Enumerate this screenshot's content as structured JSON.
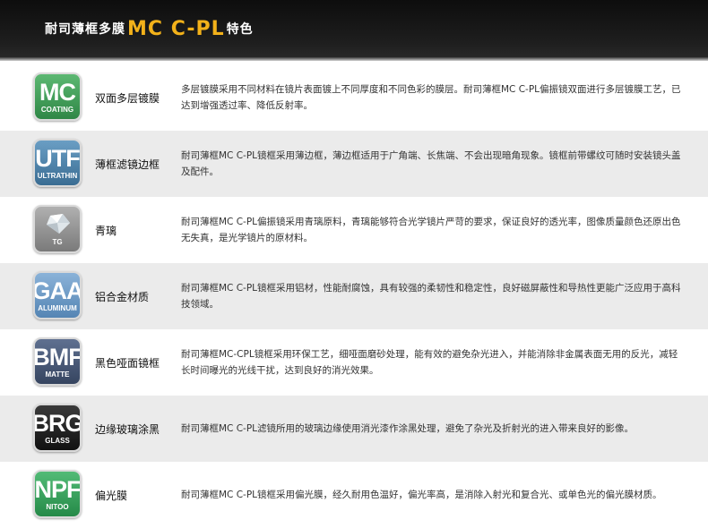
{
  "header": {
    "title_prefix": "耐司薄框多膜",
    "title_highlight": "MC C-PL",
    "title_suffix": "特色"
  },
  "colors": {
    "highlight": "#f2b11a",
    "mc": "#3e9a56",
    "utf": "#4a7fa6",
    "tg": "#8c8c8c",
    "gaa": "#6b98c6",
    "bmf": "#4a5a78",
    "brg": "#222222",
    "npf": "#35a05c"
  },
  "features": [
    {
      "icon": "mc-coating-icon",
      "abbr": "MC",
      "sub": "COATING",
      "name": "双面多层镀膜",
      "desc": "多层镀膜采用不同材料在镜片表面镀上不同厚度和不同色彩的膜层。耐司薄框MC C-PL偏振镜双面进行多层镀膜工艺，已达到增强透过率、降低反射率。"
    },
    {
      "icon": "utf-ultrathin-icon",
      "abbr": "UTF",
      "sub": "ULTRATHIN",
      "name": "薄框滤镜边框",
      "desc": "耐司薄框MC C-PL镜框采用薄边框，薄边框适用于广角端、长焦端、不会出现暗角现象。镜框前带螺纹可随时安装镜头盖及配件。"
    },
    {
      "icon": "tg-glass-icon",
      "abbr": "",
      "sub": "TG",
      "name": "青璃",
      "desc": "耐司薄框MC C-PL偏振镜采用青璃原料，青璃能够符合光学镜片严苛的要求，保证良好的透光率，图像质量颜色还原出色无失真，是光学镜片的原材料。"
    },
    {
      "icon": "gaa-aluminum-icon",
      "abbr": "GAA",
      "sub": "ALUMINUM",
      "name": "铝合金材质",
      "desc": "耐司薄框MC   C-PL镜框采用铝材，性能耐腐蚀，具有较强的柔韧性和稳定性，良好磁屏蔽性和导热性更能广泛应用于高科技领域。"
    },
    {
      "icon": "bmf-matte-icon",
      "abbr": "BMF",
      "sub": "MATTE",
      "name": "黑色哑面镜框",
      "desc": "耐司薄框MC-CPL镜框采用环保工艺，细哑面磨砂处理，能有效的避免杂光进入，并能消除非金属表面无用的反光，减轻长时间曝光的光线干扰，达到良好的消光效果。"
    },
    {
      "icon": "brg-glass-icon",
      "abbr": "BRG",
      "sub": "GLASS",
      "name": "边缘玻璃涂黑",
      "desc": "耐司薄框MC C-PL滤镜所用的玻璃边缘使用消光漆作涂黑处理，避免了杂光及折射光的进入带来良好的影像。"
    },
    {
      "icon": "npf-nitoo-icon",
      "abbr": "NPF",
      "sub": "NITOO",
      "name": "偏光膜",
      "desc": "耐司薄框MC C-PL镜框采用偏光膜，经久耐用色温好，偏光率高，是消除入射光和复合光、或单色光的偏光膜材质。"
    }
  ]
}
